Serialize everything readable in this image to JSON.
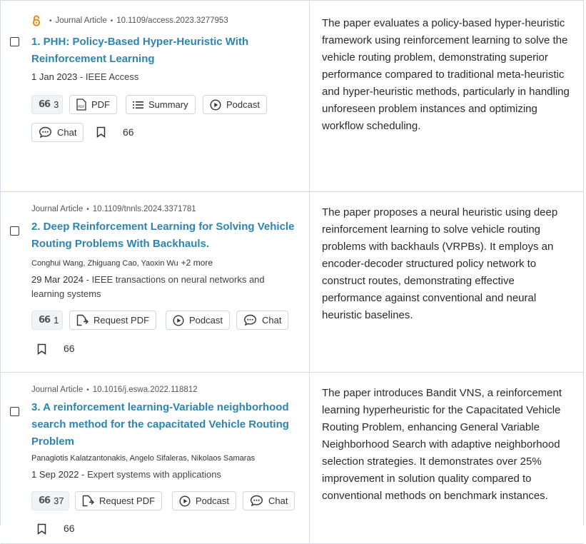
{
  "results": [
    {
      "meta": {
        "type": "Journal Article",
        "doi": "10.1109/access.2023.3277953"
      },
      "title": "1. PHH: Policy-Based Hyper-Heuristic With Reinforcement Learning",
      "pub": {
        "date": "1 Jan 2023",
        "sep": " - ",
        "venue": "IEEE Access"
      },
      "citations": "3",
      "buttons": {
        "pdf": "PDF",
        "summary": "Summary",
        "podcast": "Podcast",
        "chat": "Chat"
      },
      "bookmark_count": "66",
      "summary": "The paper evaluates a policy-based hyper-heuristic framework using reinforcement learning to solve the vehicle routing problem, demonstrating superior performance compared to traditional meta-heuristic and hyper-heuristic methods, particularly in handling unforeseen problem instances and optimizing workflow scheduling."
    },
    {
      "meta": {
        "type": "Journal Article",
        "doi": "10.1109/tnnls.2024.3371781"
      },
      "title": "2. Deep Reinforcement Learning for Solving Vehicle Routing Problems With Backhauls.",
      "authors": "Conghui Wang, Zhiguang Cao, Yaoxin Wu",
      "authors_more": "+2 more",
      "pub": {
        "date": "29 Mar 2024",
        "sep": " - ",
        "venue": "IEEE transactions on neural networks and learning systems"
      },
      "citations": "1",
      "buttons": {
        "request_pdf": "Request PDF",
        "podcast": "Podcast",
        "chat": "Chat"
      },
      "bookmark_count": "66",
      "summary": "The paper proposes a neural heuristic using deep reinforcement learning to solve vehicle routing problems with backhauls (VRPBs). It employs an encoder-decoder structured policy network to construct routes, demonstrating effective performance against conventional and neural heuristic baselines."
    },
    {
      "meta": {
        "type": "Journal Article",
        "doi": "10.1016/j.eswa.2022.118812"
      },
      "title": "3. A reinforcement learning-Variable neighborhood search method for the capacitated Vehicle Routing Problem",
      "authors": "Panagiotis Kalatzantonakis, Angelo Sifaleras, Nikolaos Samaras",
      "pub": {
        "date": "1 Sep 2022",
        "sep": " - ",
        "venue": "Expert systems with applications"
      },
      "citations": "37",
      "buttons": {
        "request_pdf": "Request PDF",
        "podcast": "Podcast",
        "chat": "Chat"
      },
      "bookmark_count": "66",
      "summary": "The paper introduces Bandit VNS, a reinforcement learning hyperheuristic for the Capacitated Vehicle Routing Problem, enhancing General Variable Neighborhood Search with adaptive neighborhood selection strategies. It demonstrates over 25% improvement in solution quality compared to conventional methods on benchmark instances."
    }
  ],
  "icons": {
    "cite": "66",
    "open_access": "open-access-icon",
    "pdf": "pdf-file-icon",
    "summary": "list-icon",
    "podcast": "play-circle-icon",
    "chat": "chat-bubble-icon",
    "bookmark": "bookmark-icon",
    "request_pdf": "file-request-icon"
  },
  "colors": {
    "title": "#2e84b0",
    "open_access": "#f68212",
    "border": "#d5dbe2"
  }
}
